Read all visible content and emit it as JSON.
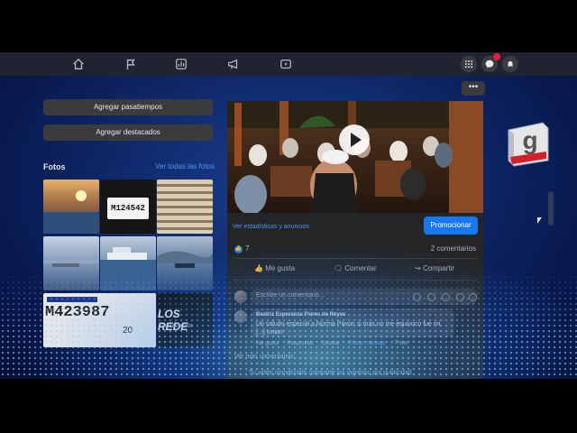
{
  "nav": {
    "icons": [
      "home-icon",
      "flag-icon",
      "chart-icon",
      "megaphone-icon",
      "video-icon"
    ],
    "right_icons": [
      "grid-icon",
      "messenger-icon",
      "bell-icon"
    ]
  },
  "left": {
    "add_hobbies": "Agregar pasatiempos",
    "add_featured": "Agregar destacados",
    "photos_title": "Fotos",
    "see_all_photos": "Ver todas las fotos",
    "plate_1": "M124542",
    "plate_2": "M423987",
    "plate_2_suffix": "20",
    "plate_brand": "LOS REDE",
    "plate_country": "EL SALVADOR"
  },
  "post": {
    "stats_link": "Ver estadísticas y anuncios",
    "promote": "Promocionar",
    "reaction_count": "7",
    "comments_count": "2 comentarios",
    "like": "Me gusta",
    "comment": "Comentar",
    "share": "Compartir",
    "comment_placeholder": "Escribe un comentario...",
    "first_comment": {
      "author": "Beatriz Esperanza Flores de Reyes",
      "text": "Un saludo especial a Norma Pavon si mas no me equivoco fue mi [...] Union",
      "actions": [
        "Me gusta",
        "Responder",
        "Ocultar",
        "Enviar mensaje",
        "7 min"
      ]
    },
    "more_comments": "Ver más comentarios",
    "monetized_notice": "Tu video monetizado comparte los ingresos por publicidad"
  },
  "colors": {
    "accent": "#1877f2",
    "link": "#4e95f5",
    "card": "#242526"
  }
}
